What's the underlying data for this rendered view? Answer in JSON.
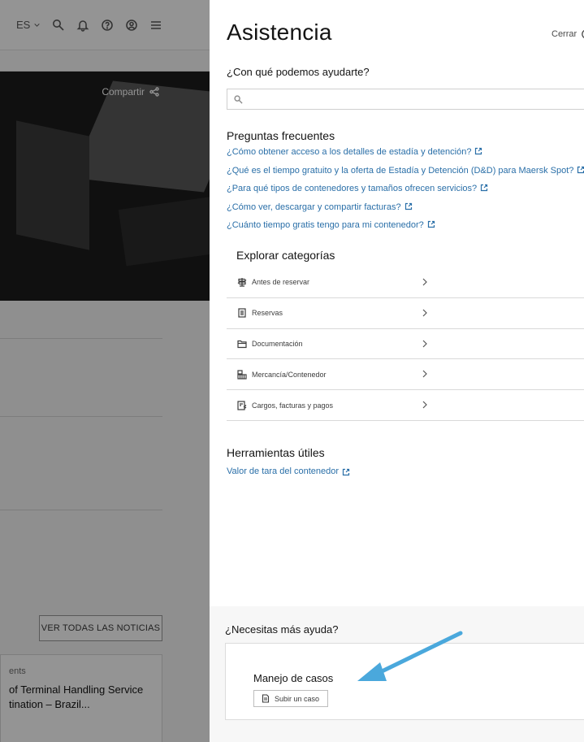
{
  "background": {
    "language": "ES",
    "share_label": "Compartir",
    "news_button": "VER TODAS LAS NOTICIAS",
    "news_card": {
      "category": "ents",
      "title": "of Terminal Handling Service tination – Brazil..."
    }
  },
  "panel": {
    "title": "Asistencia",
    "close_label": "Cerrar",
    "question": "¿Con qué podemos ayudarte?",
    "search_placeholder": "",
    "faq": {
      "title": "Preguntas frecuentes",
      "items": [
        "¿Cómo obtener acceso a los detalles de estadía y detención?",
        "¿Qué es el tiempo gratuito y la oferta de Estadía y Detención (D&D) para Maersk Spot?",
        "¿Para qué tipos de contenedores y tamaños ofrecen servicios?",
        "¿Cómo ver, descargar y compartir facturas?",
        "¿Cuánto tiempo gratis tengo para mi contenedor?"
      ]
    },
    "categories": {
      "title": "Explorar categorías",
      "items": [
        {
          "label": "Antes de reservar",
          "icon": "signpost-icon"
        },
        {
          "label": "Reservas",
          "icon": "document-icon"
        },
        {
          "label": "Documentación",
          "icon": "folder-icon"
        },
        {
          "label": "Mercancía/Contenedor",
          "icon": "container-icon"
        },
        {
          "label": "Cargos, facturas y pagos",
          "icon": "invoice-icon"
        }
      ]
    },
    "tools": {
      "title": "Herramientas útiles",
      "link": "Valor de tara del contenedor"
    },
    "more_help": {
      "title": "¿Necesitas más ayuda?",
      "case_title": "Manejo de casos",
      "case_button": "Subir un caso"
    }
  },
  "colors": {
    "link": "#2a6fa8",
    "annotation_arrow": "#4aa8dc"
  }
}
